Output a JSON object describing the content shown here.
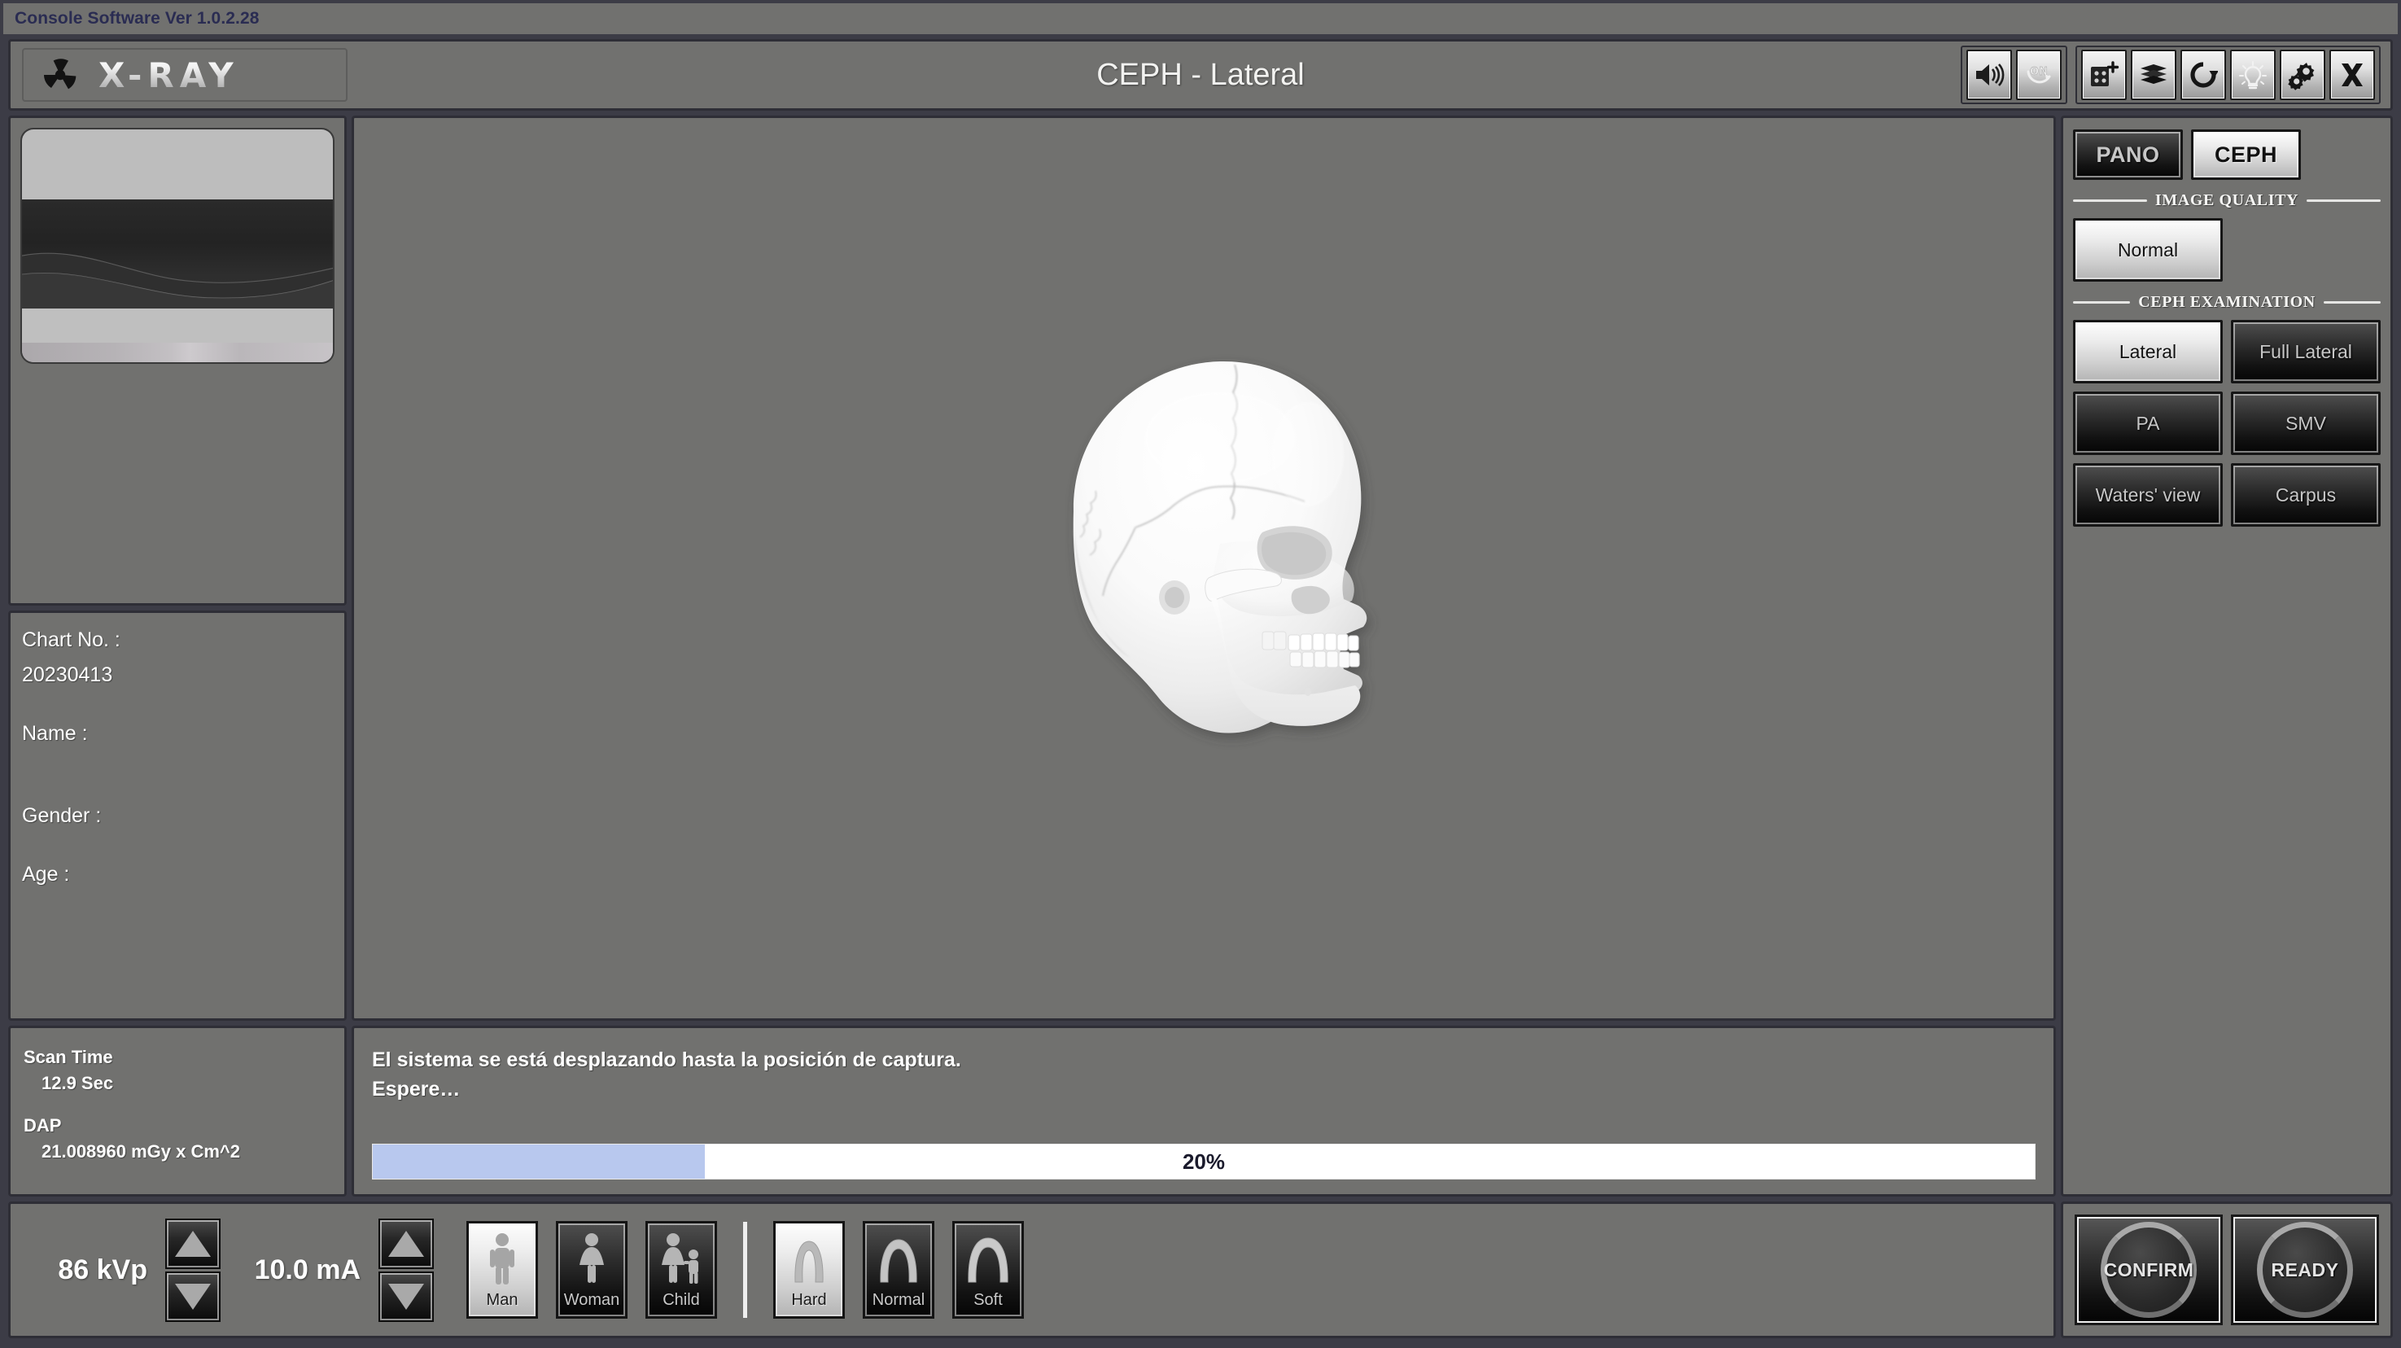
{
  "window": {
    "version_label": "Console Software Ver 1.0.2.28"
  },
  "header": {
    "logo_text": "X-RAY",
    "logo_icon": "radiation-icon",
    "title": "CEPH - Lateral",
    "icons_group_a": [
      {
        "name": "speaker-icon",
        "label": "Sound"
      },
      {
        "name": "power-on-icon",
        "label": "ON"
      }
    ],
    "icons_group_b": [
      {
        "name": "new-patient-icon",
        "label": "New Patient"
      },
      {
        "name": "image-stack-icon",
        "label": "Image List"
      },
      {
        "name": "refresh-icon",
        "label": "Refresh"
      },
      {
        "name": "lightbulb-icon",
        "label": "Lamp"
      },
      {
        "name": "gears-settings-icon",
        "label": "Settings"
      },
      {
        "name": "close-icon",
        "label": "Close"
      }
    ]
  },
  "patient": {
    "chart_label": "Chart No. :",
    "chart_value": "20230413",
    "name_label": "Name :",
    "name_value": "",
    "gender_label": "Gender :",
    "gender_value": "",
    "age_label": "Age :",
    "age_value": ""
  },
  "scan": {
    "scan_time_label": "Scan Time",
    "scan_time_value": "12.9 Sec",
    "dap_label": "DAP",
    "dap_value": "21.008960 mGy x Cm^2"
  },
  "status": {
    "message_line1": "El sistema se está desplazando hasta la posición de captura.",
    "message_line2": "Espere…",
    "progress_percent": 20,
    "progress_text": "20%",
    "progress_fill_color": "#b8c8ee"
  },
  "viewer": {
    "image_name": "lateral-skull-illustration"
  },
  "sidebar": {
    "modes": [
      {
        "label": "PANO",
        "selected": false
      },
      {
        "label": "CEPH",
        "selected": true
      }
    ],
    "image_quality_title": "IMAGE QUALITY",
    "image_quality_options": [
      {
        "label": "Normal",
        "selected": true
      }
    ],
    "examination_title": "CEPH EXAMINATION",
    "examination_options": [
      {
        "label": "Lateral",
        "selected": true
      },
      {
        "label": "Full Lateral",
        "selected": false
      },
      {
        "label": "PA",
        "selected": false
      },
      {
        "label": "SMV",
        "selected": false
      },
      {
        "label": "Waters' view",
        "selected": false
      },
      {
        "label": "Carpus",
        "selected": false
      }
    ]
  },
  "footer": {
    "kvp_value": "86 kVp",
    "ma_value": "10.0 mA",
    "patient_types": [
      {
        "label": "Man",
        "icon": "man-icon",
        "selected": true
      },
      {
        "label": "Woman",
        "icon": "woman-icon",
        "selected": false
      },
      {
        "label": "Child",
        "icon": "child-icon",
        "selected": false
      }
    ],
    "arch_types": [
      {
        "label": "Hard",
        "icon": "arch-hard-icon",
        "selected": true
      },
      {
        "label": "Normal",
        "icon": "arch-normal-icon",
        "selected": false
      },
      {
        "label": "Soft",
        "icon": "arch-soft-icon",
        "selected": false
      }
    ],
    "actions": [
      {
        "label": "CONFIRM"
      },
      {
        "label": "READY"
      }
    ]
  },
  "colors": {
    "background": "#71716f",
    "chrome": "#3c3c46",
    "version_text": "#2a2c52",
    "progress_fill": "#b8c8ee"
  }
}
